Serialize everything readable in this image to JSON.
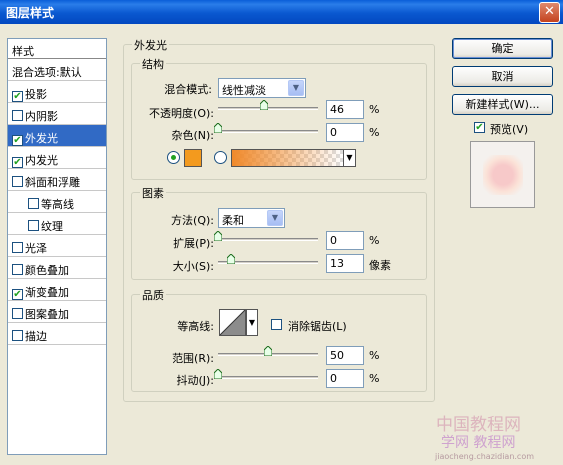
{
  "window": {
    "title": "图层样式",
    "close_symbol": "✕"
  },
  "style_list": {
    "header": "样式",
    "items": [
      {
        "label": "混合选项:默认",
        "checkbox": false,
        "checked": false,
        "indent": false,
        "selected": false
      },
      {
        "label": "投影",
        "checkbox": true,
        "checked": true,
        "indent": false,
        "selected": false
      },
      {
        "label": "内阴影",
        "checkbox": true,
        "checked": false,
        "indent": false,
        "selected": false
      },
      {
        "label": "外发光",
        "checkbox": true,
        "checked": true,
        "indent": false,
        "selected": true
      },
      {
        "label": "内发光",
        "checkbox": true,
        "checked": true,
        "indent": false,
        "selected": false
      },
      {
        "label": "斜面和浮雕",
        "checkbox": true,
        "checked": false,
        "indent": false,
        "selected": false
      },
      {
        "label": "等高线",
        "checkbox": true,
        "checked": false,
        "indent": true,
        "selected": false
      },
      {
        "label": "纹理",
        "checkbox": true,
        "checked": false,
        "indent": true,
        "selected": false
      },
      {
        "label": "光泽",
        "checkbox": true,
        "checked": false,
        "indent": false,
        "selected": false
      },
      {
        "label": "颜色叠加",
        "checkbox": true,
        "checked": false,
        "indent": false,
        "selected": false
      },
      {
        "label": "渐变叠加",
        "checkbox": true,
        "checked": true,
        "indent": false,
        "selected": false
      },
      {
        "label": "图案叠加",
        "checkbox": true,
        "checked": false,
        "indent": false,
        "selected": false
      },
      {
        "label": "描边",
        "checkbox": true,
        "checked": false,
        "indent": false,
        "selected": false
      }
    ]
  },
  "outer_glow": {
    "title": "外发光",
    "structure": {
      "title": "结构",
      "blend_mode_label": "混合模式:",
      "blend_mode_value": "线性减淡",
      "opacity_label": "不透明度(O):",
      "opacity_value": "46",
      "opacity_level": 46,
      "opacity_unit": "%",
      "noise_label": "杂色(N):",
      "noise_value": "0",
      "noise_level": 0,
      "noise_unit": "%",
      "swatch_color": "#f39a1e",
      "gradient_start": "#f0892a",
      "color_radio_selected": true
    },
    "elements": {
      "title": "图素",
      "method_label": "方法(Q):",
      "method_value": "柔和",
      "spread_label": "扩展(P):",
      "spread_value": "0",
      "spread_level": 0,
      "spread_unit": "%",
      "size_label": "大小(S):",
      "size_value": "13",
      "size_level": 13,
      "size_unit": "像素"
    },
    "quality": {
      "title": "品质",
      "contour_label": "等高线:",
      "antialias_label": "消除锯齿(L)",
      "antialias_checked": false,
      "range_label": "范围(R):",
      "range_value": "50",
      "range_level": 50,
      "range_unit": "%",
      "jitter_label": "抖动(J):",
      "jitter_value": "0",
      "jitter_level": 0,
      "jitter_unit": "%"
    }
  },
  "buttons": {
    "ok": "确定",
    "cancel": "取消",
    "new_style": "新建样式(W)...",
    "preview_label": "预览(V)",
    "preview_checked": true
  },
  "watermark": {
    "line1": "中国教程网",
    "line2": "学网 教程网",
    "line3": "jiaocheng.chazidian.com"
  },
  "colors": {
    "selection": "#316ac5",
    "check_green": "#21a121",
    "title_bar": "#0a5ed8"
  }
}
